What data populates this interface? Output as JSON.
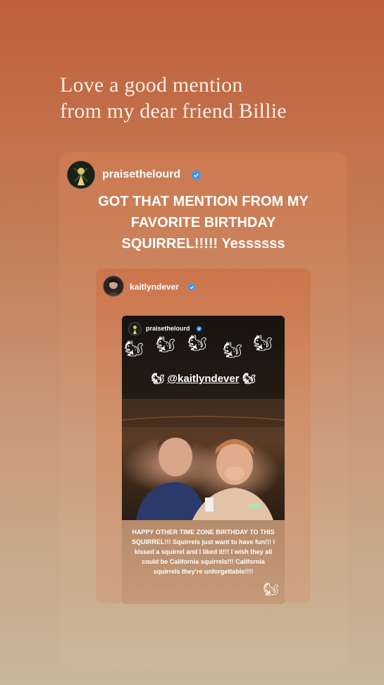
{
  "caption": {
    "line1": "Love a good mention",
    "line2": "from my dear friend Billie"
  },
  "outer_post": {
    "username": "praisethelourd",
    "verified": true,
    "text_line1": "GOT THAT MENTION FROM MY",
    "text_line2": "FAVORITE BIRTHDAY",
    "text_line3": "SQUIRREL!!!!! Yessssss"
  },
  "inner_post": {
    "username": "kaitlyndever",
    "verified": true
  },
  "story": {
    "username": "praisethelourd",
    "verified": true,
    "stickers": [
      "squirrel-drinking-sticker",
      "squirrel-sticker",
      "squirrel-face-sticker",
      "squirrel-eating-sticker",
      "squirrel-sticker"
    ],
    "mention_prefix": "🐿",
    "mention": "@kaitlyndever",
    "mention_suffix": "🐿",
    "caption": "HAPPY OTHER TIME ZONE BIRTHDAY TO THIS SQUIRREL!!! Squirrels just want to have fun!!! I kissed a squirrel and I liked it!!! I wish they all could be California squirrels!!! California squirrels they're unforgettable!!!!"
  },
  "colors": {
    "verified_badge": "#3a97f0",
    "background_top": "#c0603a",
    "background_bottom": "#c7b79b"
  }
}
